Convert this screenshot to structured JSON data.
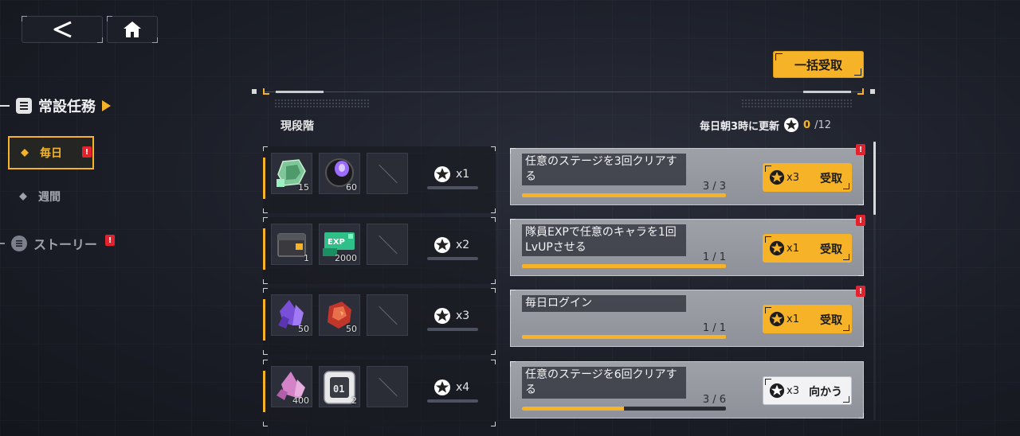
{
  "colors": {
    "accent": "#f6b327",
    "alert": "#e4222e",
    "panel": "#9ea1a8"
  },
  "nav": {
    "back_icon": "back-chevron-icon",
    "home_icon": "home-icon"
  },
  "sidebar": {
    "section_main": "常設任務",
    "daily": "毎日",
    "weekly": "週間",
    "story": "ストーリー",
    "badge": "!"
  },
  "header": {
    "collect_all": "一括受取",
    "stage_label": "現段階",
    "refresh_text": "毎日朝3時に更新",
    "points_current": "0",
    "points_total": "/12"
  },
  "rows": [
    {
      "items": [
        {
          "icon": "green-cube-icon",
          "qty": "15"
        },
        {
          "icon": "purple-device-icon",
          "qty": "60"
        }
      ],
      "star_reward": "x1",
      "task": "任意のステージを3回クリアする",
      "progress": "3 / 3",
      "progress_ratio": 1.0,
      "claim_star": "x3",
      "claim_label": "受取",
      "claim_style": "yellow"
    },
    {
      "items": [
        {
          "icon": "supply-crate-icon",
          "qty": "1"
        },
        {
          "icon": "exp-card-icon",
          "qty": "2000"
        }
      ],
      "star_reward": "x2",
      "task": "隊員EXPで任意のキャラを1回LvUPさせる",
      "progress": "1 / 1",
      "progress_ratio": 1.0,
      "claim_star": "x1",
      "claim_label": "受取",
      "claim_style": "yellow"
    },
    {
      "items": [
        {
          "icon": "purple-crystal-icon",
          "qty": "50"
        },
        {
          "icon": "red-ore-icon",
          "qty": "50"
        }
      ],
      "star_reward": "x3",
      "task": "毎日ログイン",
      "progress": "1 / 1",
      "progress_ratio": 1.0,
      "claim_star": "x1",
      "claim_label": "受取",
      "claim_style": "yellow"
    },
    {
      "items": [
        {
          "icon": "pink-crystal-icon",
          "qty": "400"
        },
        {
          "icon": "chip-01-icon",
          "qty": "2"
        }
      ],
      "star_reward": "x4",
      "task": "任意のステージを6回クリアする",
      "progress": "3 / 6",
      "progress_ratio": 0.5,
      "claim_star": "x3",
      "claim_label": "向かう",
      "claim_style": "white"
    }
  ],
  "icons": {
    "star": "star-emblem-icon",
    "list": "list-icon",
    "story": "story-icon",
    "diamond": "diamond-icon"
  }
}
